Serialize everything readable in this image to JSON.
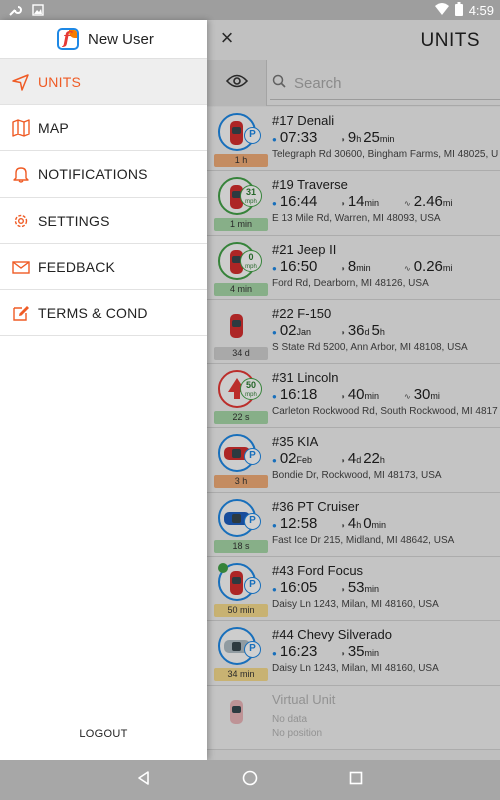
{
  "status_bar": {
    "time": "4:59",
    "icons": [
      "wrench-icon",
      "image-icon",
      "wifi-icon",
      "battery-icon"
    ]
  },
  "drawer": {
    "app_logo_letter": "f",
    "user_name": "New User",
    "items": [
      {
        "label": "UNITS",
        "icon": "navigation-arrow-icon",
        "active": true
      },
      {
        "label": "MAP",
        "icon": "map-icon",
        "active": false
      },
      {
        "label": "NOTIFICATIONS",
        "icon": "bell-icon",
        "active": false
      },
      {
        "label": "SETTINGS",
        "icon": "gear-icon",
        "active": false
      },
      {
        "label": "FEEDBACK",
        "icon": "envelope-icon",
        "active": false
      },
      {
        "label": "TERMS & COND",
        "icon": "edit-document-icon",
        "active": false
      }
    ],
    "logout_label": "LOGOUT"
  },
  "main": {
    "title": "UNITS",
    "close_glyph": "×",
    "search": {
      "placeholder": "Search",
      "value": ""
    },
    "units": [
      {
        "name": "#17 Denali",
        "time": "07:33",
        "dur_a": "9",
        "dur_a_unit": "h",
        "dur_b": "25",
        "dur_b_unit": "min",
        "dist": "",
        "dist_unit": "",
        "address": "Telegraph Rd 30600, Bingham Farms, MI 48025, U",
        "age": "1 h",
        "speed": ""
      },
      {
        "name": "#19 Traverse",
        "time": "16:44",
        "dur_a": "14",
        "dur_a_unit": "min",
        "dur_b": "",
        "dur_b_unit": "",
        "dist": "2.46",
        "dist_unit": "mi",
        "address": "E 13 Mile Rd, Warren, MI 48093, USA",
        "age": "1 min",
        "speed": "31"
      },
      {
        "name": "#21 Jeep II",
        "time": "16:50",
        "dur_a": "8",
        "dur_a_unit": "min",
        "dur_b": "",
        "dur_b_unit": "",
        "dist": "0.26",
        "dist_unit": "mi",
        "address": "Ford Rd, Dearborn, MI 48126, USA",
        "age": "4 min",
        "speed": "0"
      },
      {
        "name": "#22 F-150",
        "time": "02",
        "time_unit": "Jan",
        "dur_a": "36",
        "dur_a_unit": "d",
        "dur_b": "5",
        "dur_b_unit": "h",
        "dist": "",
        "dist_unit": "",
        "address": "S State Rd 5200, Ann Arbor, MI 48108, USA",
        "age": "34 d",
        "speed": ""
      },
      {
        "name": "#31 Lincoln",
        "time": "16:18",
        "dur_a": "40",
        "dur_a_unit": "min",
        "dur_b": "",
        "dur_b_unit": "",
        "dist": "30",
        "dist_unit": "mi",
        "address": "Carleton Rockwood Rd, South Rockwood, MI 4817",
        "age": "22 s",
        "speed": "50"
      },
      {
        "name": "#35 KIA",
        "time": "02",
        "time_unit": "Feb",
        "dur_a": "4",
        "dur_a_unit": "d",
        "dur_b": "22",
        "dur_b_unit": "h",
        "dist": "",
        "dist_unit": "",
        "address": "Bondie Dr, Rockwood, MI 48173, USA",
        "age": "3 h",
        "speed": ""
      },
      {
        "name": "#36 PT Cruiser",
        "time": "12:58",
        "dur_a": "4",
        "dur_a_unit": "h",
        "dur_b": "0",
        "dur_b_unit": "min",
        "dist": "",
        "dist_unit": "",
        "address": "Fast Ice Dr 215, Midland, MI 48642, USA",
        "age": "18 s",
        "speed": ""
      },
      {
        "name": "#43 Ford Focus",
        "time": "16:05",
        "dur_a": "53",
        "dur_a_unit": "min",
        "dur_b": "",
        "dur_b_unit": "",
        "dist": "",
        "dist_unit": "",
        "address": "Daisy Ln 1243, Milan, MI 48160, USA",
        "age": "50 min",
        "speed": ""
      },
      {
        "name": "#44 Chevy Silverado",
        "time": "16:23",
        "dur_a": "35",
        "dur_a_unit": "min",
        "dur_b": "",
        "dur_b_unit": "",
        "dist": "",
        "dist_unit": "",
        "address": "Daisy Ln 1243, Milan, MI 48160, USA",
        "age": "34 min",
        "speed": ""
      },
      {
        "name": "Virtual Unit",
        "line2": "No data",
        "address": "No position",
        "age": ""
      }
    ],
    "speed_unit": "mph"
  },
  "colors": {
    "accent": "#ef5b25",
    "blue": "#1e88e5",
    "green": "#43a047",
    "red": "#e53935"
  }
}
